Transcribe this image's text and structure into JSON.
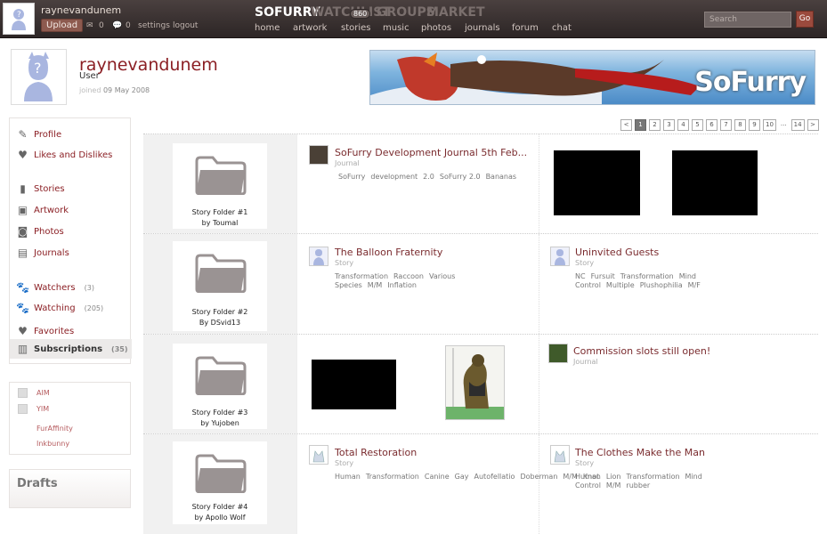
{
  "topbar": {
    "username": "raynevandunem",
    "upload": "Upload",
    "mail_count": "0",
    "comments_count": "0",
    "settings": "settings",
    "logout": "logout",
    "nav_main": [
      "SOFURRY",
      "WATCHLIST",
      "GROUPS",
      "MARKET"
    ],
    "watch_count": "860",
    "nav_sub": [
      "home",
      "artwork",
      "stories",
      "music",
      "photos",
      "journals",
      "forum",
      "chat"
    ],
    "search_placeholder": "Search",
    "go": "Go"
  },
  "profile": {
    "name": "raynevandunem",
    "role": "User",
    "joined_prefix": "joined",
    "joined_date": "09 May 2008",
    "banner_logo": "SoFurry"
  },
  "pager": [
    "<",
    "1",
    "2",
    "3",
    "4",
    "5",
    "6",
    "7",
    "8",
    "9",
    "10",
    "...",
    "14",
    ">"
  ],
  "sidebar": {
    "items": [
      {
        "label": "Profile",
        "icon": "pencil-icon"
      },
      {
        "label": "Likes and Dislikes",
        "icon": "heart-icon"
      },
      {
        "label": "Stories",
        "icon": "book-icon"
      },
      {
        "label": "Artwork",
        "icon": "picture-icon"
      },
      {
        "label": "Photos",
        "icon": "camera-icon"
      },
      {
        "label": "Journals",
        "icon": "journal-icon"
      },
      {
        "label": "Watchers",
        "count": "(3)",
        "icon": "paw-icon"
      },
      {
        "label": "Watching",
        "count": "(205)",
        "icon": "paw-icon"
      },
      {
        "label": "Favorites",
        "icon": "heart-icon"
      },
      {
        "label": "Subscriptions",
        "count": "(35)",
        "icon": "subscriptions-icon"
      }
    ],
    "contacts": [
      "AIM",
      "YIM",
      "FurAffinity",
      "Inkbunny"
    ],
    "drafts": "Drafts"
  },
  "rows": [
    {
      "folder": {
        "name": "Story Folder #1",
        "by": "by Toumal"
      },
      "mid": {
        "title": "SoFurry Development Journal 5th Feb...",
        "type": "Journal",
        "tags": [
          "SoFurry",
          "development",
          "2.0",
          "SoFurry 2.0",
          "Bananas"
        ]
      },
      "right": {}
    },
    {
      "folder": {
        "name": "Story Folder #2",
        "by": "By DSvid13"
      },
      "mid": {
        "title": "The Balloon Fraternity",
        "type": "Story",
        "tags": [
          "Transformation",
          "Raccoon",
          "Various Species",
          "M/M",
          "Inflation"
        ]
      },
      "right": {
        "title": "Uninvited Guests",
        "type": "Story",
        "tags": [
          "NC",
          "Fursuit",
          "Transformation",
          "Mind Control",
          "Multiple",
          "Plushophilia",
          "M/F"
        ]
      }
    },
    {
      "folder": {
        "name": "Story Folder #3",
        "by": "by Yujoben"
      },
      "mid": {},
      "right": {
        "title": "Commission slots still open!",
        "type": "Journal"
      }
    },
    {
      "folder": {
        "name": "Story Folder #4",
        "by": "by Apollo Wolf"
      },
      "mid": {
        "title": "Total Restoration",
        "type": "Story",
        "tags": [
          "Human",
          "Transformation",
          "Canine",
          "Gay",
          "Autofellatio",
          "Doberman",
          "M/M",
          "Knot"
        ]
      },
      "right": {
        "title": "The Clothes Make the Man",
        "type": "Story",
        "tags": [
          "Human",
          "Lion",
          "Transformation",
          "Mind Control",
          "M/M",
          "rubber"
        ]
      }
    }
  ],
  "colors": {
    "accent": "#8b1f24",
    "topbar": "#3a3131",
    "link": "#7a2b2e"
  }
}
